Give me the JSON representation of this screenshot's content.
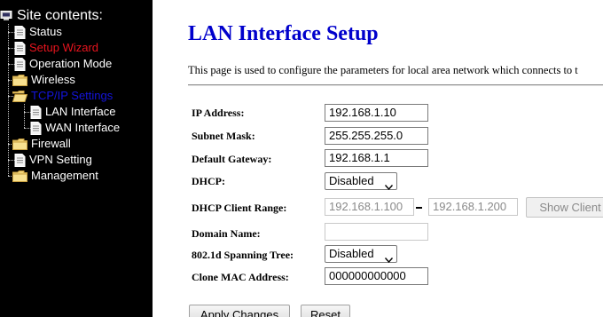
{
  "sidebar": {
    "root_label": "Site contents:",
    "items": [
      {
        "label": "Status"
      },
      {
        "label": "Setup Wizard"
      },
      {
        "label": "Operation Mode"
      },
      {
        "label": "Wireless"
      },
      {
        "label": "TCP/IP Settings"
      },
      {
        "label": "LAN Interface"
      },
      {
        "label": "WAN Interface"
      },
      {
        "label": "Firewall"
      },
      {
        "label": "VPN Setting"
      },
      {
        "label": "Management"
      }
    ]
  },
  "page": {
    "title": "LAN Interface Setup",
    "description": "This page is used to configure the parameters for local area network which connects to t"
  },
  "form": {
    "ip_address": {
      "label": "IP Address:",
      "value": "192.168.1.10"
    },
    "subnet_mask": {
      "label": "Subnet Mask:",
      "value": "255.255.255.0"
    },
    "default_gateway": {
      "label": "Default Gateway:",
      "value": "192.168.1.1"
    },
    "dhcp": {
      "label": "DHCP:",
      "selected": "Disabled"
    },
    "dhcp_range": {
      "label": "DHCP Client Range:",
      "start": "192.168.1.100",
      "end": "192.168.1.200",
      "show_client_label": "Show Client"
    },
    "domain_name": {
      "label": "Domain Name:",
      "value": ""
    },
    "spanning_tree": {
      "label": "802.1d Spanning Tree:",
      "selected": "Disabled"
    },
    "clone_mac": {
      "label": "Clone MAC Address:",
      "value": "000000000000"
    }
  },
  "buttons": {
    "apply": "Apply Changes",
    "reset": "Reset"
  },
  "colors": {
    "sidebar_bg": "#000000",
    "title_blue": "#0000cc",
    "active_red": "#e8141e",
    "selected_blue": "#1414dc"
  },
  "icons": {
    "root": "computer-icon",
    "page": "document-icon",
    "folder": "folder-icon"
  }
}
